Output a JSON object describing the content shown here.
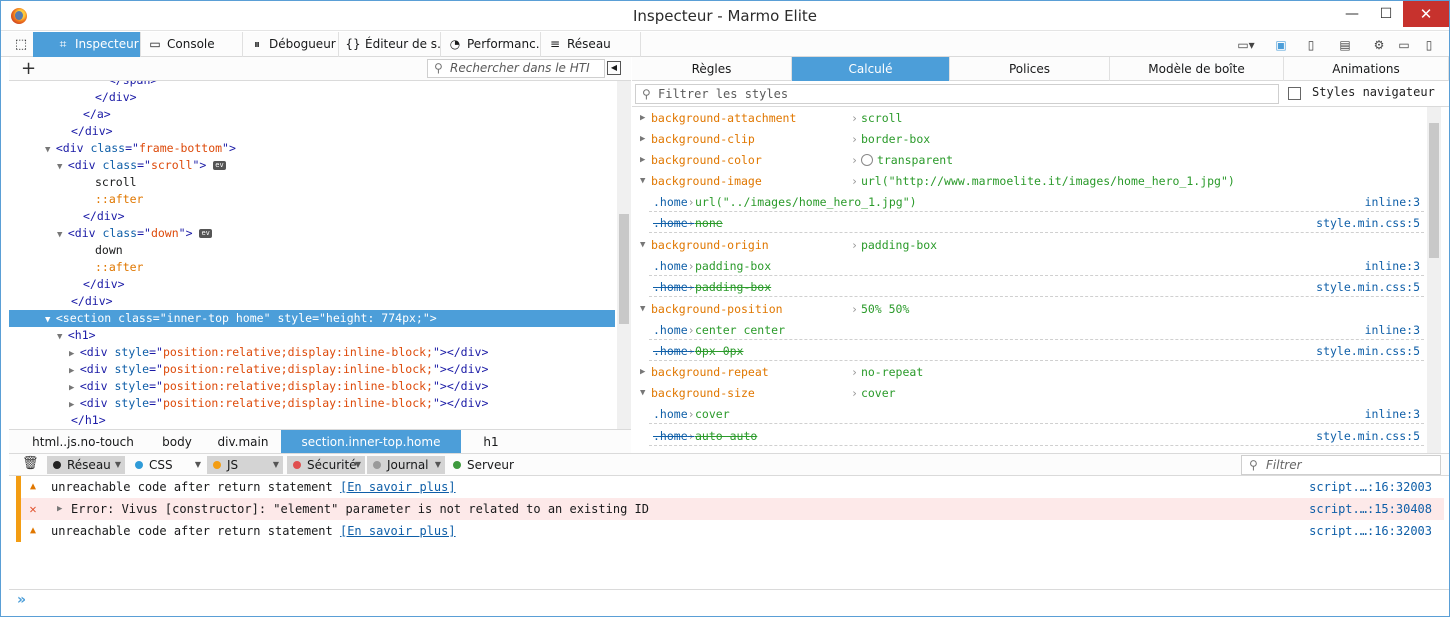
{
  "window": {
    "title": "Inspecteur - Marmo Elite"
  },
  "toolbox": {
    "tabs": [
      {
        "label": "Inspecteur",
        "icon": "inspector-icon"
      },
      {
        "label": "Console",
        "icon": "console-icon"
      },
      {
        "label": "Débogueur",
        "icon": "debugger-icon"
      },
      {
        "label": "Éditeur de s…",
        "icon": "style-editor-icon"
      },
      {
        "label": "Performanc…",
        "icon": "performance-icon"
      },
      {
        "label": "Réseau",
        "icon": "network-icon"
      }
    ]
  },
  "markup": {
    "search_placeholder": "Rechercher dans le HTI",
    "lines": [
      {
        "indent": 6,
        "parts": [
          [
            "t",
            "  </span>"
          ]
        ]
      },
      {
        "indent": 6,
        "parts": [
          [
            "t",
            "</div>"
          ]
        ]
      },
      {
        "indent": 5,
        "parts": [
          [
            "t",
            "</a>"
          ]
        ]
      },
      {
        "indent": 4,
        "parts": [
          [
            "t",
            "</div>"
          ]
        ]
      },
      {
        "indent": 3,
        "arrow": "▼",
        "parts": [
          [
            "t",
            "<div "
          ],
          [
            "a",
            "class"
          ],
          [
            "t",
            "=\""
          ],
          [
            "v",
            "frame-bottom"
          ],
          [
            "t",
            "\">"
          ]
        ]
      },
      {
        "indent": 4,
        "arrow": "▼",
        "parts": [
          [
            "t",
            "<div "
          ],
          [
            "a",
            "class"
          ],
          [
            "t",
            "=\""
          ],
          [
            "v",
            "scroll"
          ],
          [
            "t",
            "\">"
          ]
        ],
        "ev": true
      },
      {
        "indent": 6,
        "parts": [
          [
            "p0",
            "scroll"
          ]
        ]
      },
      {
        "indent": 6,
        "parts": [
          [
            "p",
            "::after"
          ]
        ]
      },
      {
        "indent": 5,
        "parts": [
          [
            "t",
            "</div>"
          ]
        ]
      },
      {
        "indent": 4,
        "arrow": "▼",
        "parts": [
          [
            "t",
            "<div "
          ],
          [
            "a",
            "class"
          ],
          [
            "t",
            "=\""
          ],
          [
            "v",
            "down"
          ],
          [
            "t",
            "\">"
          ]
        ],
        "ev": true
      },
      {
        "indent": 6,
        "parts": [
          [
            "p0",
            "down"
          ]
        ]
      },
      {
        "indent": 6,
        "parts": [
          [
            "p",
            "::after"
          ]
        ]
      },
      {
        "indent": 5,
        "parts": [
          [
            "t",
            "</div>"
          ]
        ]
      },
      {
        "indent": 4,
        "parts": [
          [
            "t",
            "</div>"
          ]
        ]
      },
      {
        "indent": 3,
        "arrow": "▼",
        "sel": true,
        "parts": [
          [
            "t",
            "<section "
          ],
          [
            "a",
            "class"
          ],
          [
            "t",
            "=\""
          ],
          [
            "v",
            "inner-top home"
          ],
          [
            "t",
            "\" "
          ],
          [
            "a",
            "style"
          ],
          [
            "t",
            "=\""
          ],
          [
            "v",
            "height: 774px;"
          ],
          [
            "t",
            "\">"
          ]
        ]
      },
      {
        "indent": 4,
        "arrow": "▼",
        "parts": [
          [
            "t",
            "<h1>"
          ]
        ]
      },
      {
        "indent": 5,
        "arrow": "▶",
        "parts": [
          [
            "t",
            "<div "
          ],
          [
            "a",
            "style"
          ],
          [
            "t",
            "=\""
          ],
          [
            "v",
            "position:relative;display:inline-block;"
          ],
          [
            "t",
            "\"></div>"
          ]
        ]
      },
      {
        "indent": 5,
        "arrow": "▶",
        "parts": [
          [
            "t",
            "<div "
          ],
          [
            "a",
            "style"
          ],
          [
            "t",
            "=\""
          ],
          [
            "v",
            "position:relative;display:inline-block;"
          ],
          [
            "t",
            "\"></div>"
          ]
        ]
      },
      {
        "indent": 5,
        "arrow": "▶",
        "parts": [
          [
            "t",
            "<div "
          ],
          [
            "a",
            "style"
          ],
          [
            "t",
            "=\""
          ],
          [
            "v",
            "position:relative;display:inline-block;"
          ],
          [
            "t",
            "\"></div>"
          ]
        ]
      },
      {
        "indent": 5,
        "arrow": "▶",
        "parts": [
          [
            "t",
            "<div "
          ],
          [
            "a",
            "style"
          ],
          [
            "t",
            "=\""
          ],
          [
            "v",
            "position:relative;display:inline-block;"
          ],
          [
            "t",
            "\"></div>"
          ]
        ]
      },
      {
        "indent": 4,
        "parts": [
          [
            "t",
            "</h1>"
          ]
        ]
      }
    ],
    "breadcrumbs": [
      "html..js.no-touch",
      "body",
      "div.main",
      "section.inner-top.home",
      "h1"
    ]
  },
  "sidebar": {
    "tabs": [
      "Règles",
      "Calculé",
      "Polices",
      "Modèle de boîte",
      "Animations"
    ],
    "active_tab": "Calculé",
    "filter_placeholder": "Filtrer les styles",
    "browser_styles_label": "Styles navigateur",
    "rows": [
      {
        "kind": "prop",
        "twisty": "▶",
        "name": "background-attachment",
        "value": "scroll"
      },
      {
        "kind": "prop",
        "twisty": "▶",
        "name": "background-clip",
        "value": "border-box"
      },
      {
        "kind": "prop",
        "twisty": "▶",
        "name": "background-color",
        "value": "transparent",
        "swatch": true
      },
      {
        "kind": "prop",
        "twisty": "▼",
        "name": "background-image",
        "value": "url(\"http://www.marmoelite.it/images/home_hero_1.jpg\")"
      },
      {
        "kind": "match",
        "selector": ".home",
        "value": "url(\"../images/home_hero_1.jpg\")",
        "source": "inline:3"
      },
      {
        "kind": "match",
        "over": true,
        "selector": ".home",
        "value": "none",
        "source": "style.min.css:5"
      },
      {
        "kind": "prop",
        "twisty": "▼",
        "name": "background-origin",
        "value": "padding-box"
      },
      {
        "kind": "match",
        "selector": ".home",
        "value": "padding-box",
        "source": "inline:3"
      },
      {
        "kind": "match",
        "over": true,
        "selector": ".home",
        "value": "padding-box",
        "source": "style.min.css:5"
      },
      {
        "kind": "prop",
        "twisty": "▼",
        "name": "background-position",
        "value": "50% 50%"
      },
      {
        "kind": "match",
        "selector": ".home",
        "value": "center center",
        "source": "inline:3"
      },
      {
        "kind": "match",
        "over": true,
        "selector": ".home",
        "value": "0px 0px",
        "source": "style.min.css:5"
      },
      {
        "kind": "prop",
        "twisty": "▶",
        "name": "background-repeat",
        "value": "no-repeat"
      },
      {
        "kind": "prop",
        "twisty": "▼",
        "name": "background-size",
        "value": "cover"
      },
      {
        "kind": "match",
        "selector": ".home",
        "value": "cover",
        "source": "inline:3"
      },
      {
        "kind": "match",
        "over": true,
        "selector": ".home",
        "value": "auto auto",
        "source": "style.min.css:5"
      }
    ]
  },
  "console": {
    "filters": [
      {
        "label": "Réseau",
        "on": true,
        "color": "#222222"
      },
      {
        "label": "CSS",
        "on": false,
        "color": "#2f9bd8"
      },
      {
        "label": "JS",
        "on": true,
        "color": "#f39d13"
      },
      {
        "label": "Sécurité",
        "on": true,
        "color": "#e04f4f"
      },
      {
        "label": "Journal",
        "on": true,
        "color": "#9a9a9a"
      },
      {
        "label": "Serveur",
        "on": false,
        "color": "#3e9a3e"
      }
    ],
    "filter_placeholder": "Filtrer",
    "messages": [
      {
        "type": "warning",
        "text": "unreachable code after return statement ",
        "link": "[En savoir plus]",
        "location": "script.…:16:32003"
      },
      {
        "type": "error",
        "text": "Error: Vivus [constructor]: \"element\" parameter is not related to an existing ID",
        "link": "",
        "location": "script.…:15:30408"
      },
      {
        "type": "warning",
        "text": "unreachable code after return statement ",
        "link": "[En savoir plus]",
        "location": "script.…:16:32003"
      }
    ],
    "prompt": "»"
  }
}
